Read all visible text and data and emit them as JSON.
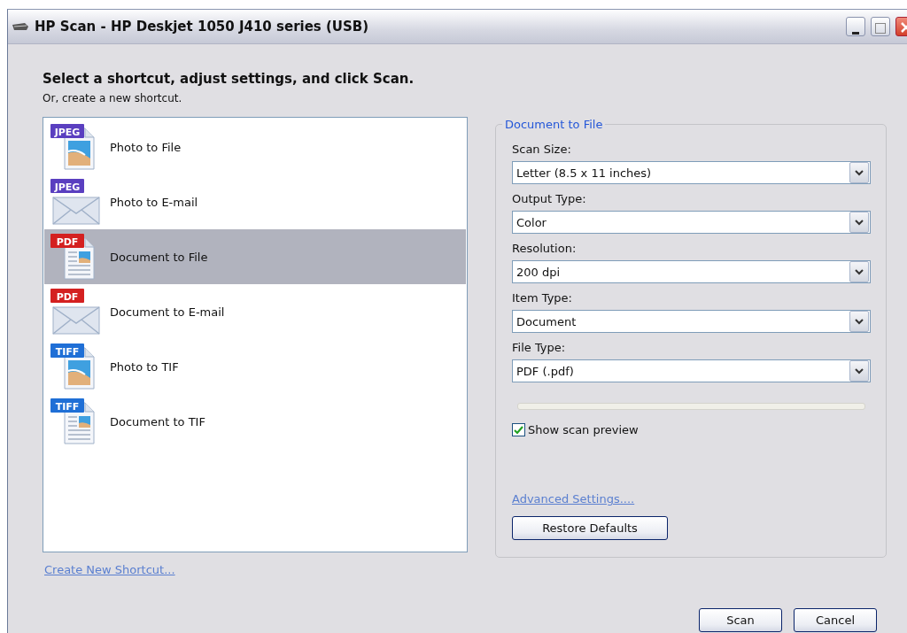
{
  "window": {
    "title": "HP Scan - HP Deskjet 1050 J410 series (USB)"
  },
  "heading": "Select a shortcut, adjust settings, and click Scan.",
  "subheading": "Or, create a new shortcut.",
  "shortcuts": [
    {
      "label": "Photo to File",
      "badge": "JPEG",
      "kind": "photo-file",
      "selected": false
    },
    {
      "label": "Photo to E-mail",
      "badge": "JPEG",
      "kind": "mail",
      "selected": false
    },
    {
      "label": "Document to File",
      "badge": "PDF",
      "kind": "doc-file",
      "selected": true
    },
    {
      "label": "Document to E-mail",
      "badge": "PDF",
      "kind": "mail",
      "selected": false
    },
    {
      "label": "Photo to TIF",
      "badge": "TIFF",
      "kind": "photo-file",
      "selected": false
    },
    {
      "label": "Document to TIF",
      "badge": "TIFF",
      "kind": "doc-file",
      "selected": false
    }
  ],
  "create_link": "Create New Shortcut...",
  "settings": {
    "title": "Document to File",
    "fields": [
      {
        "label": "Scan Size:",
        "value": "Letter (8.5 x 11 inches)"
      },
      {
        "label": "Output Type:",
        "value": "Color"
      },
      {
        "label": "Resolution:",
        "value": "200 dpi"
      },
      {
        "label": "Item Type:",
        "value": "Document"
      },
      {
        "label": "File Type:",
        "value": "PDF (.pdf)"
      }
    ],
    "progress": {
      "level": 0
    },
    "preview": {
      "label": "Show scan preview",
      "checked": true
    },
    "advanced_link": "Advanced Settings....",
    "restore_button": "Restore Defaults"
  },
  "buttons": [
    "Scan",
    "Cancel"
  ]
}
